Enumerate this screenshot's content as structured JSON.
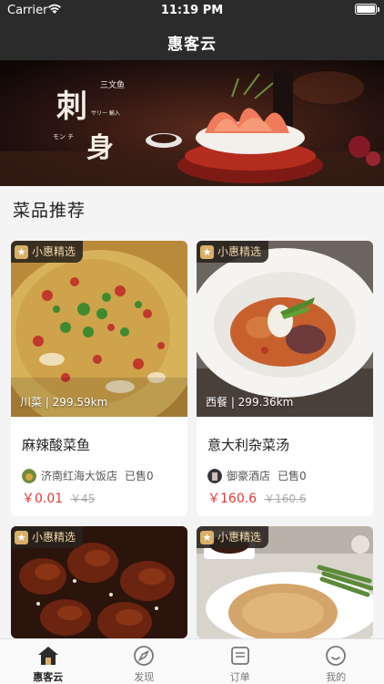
{
  "status": {
    "carrier": "Carrier",
    "time": "11:19 PM"
  },
  "nav": {
    "title": "惠客云"
  },
  "banner": {
    "text": [
      "刺",
      "身",
      "三文鱼",
      "モン チ",
      "サリー 輸入"
    ]
  },
  "section": {
    "title": "菜品推荐"
  },
  "cards": [
    {
      "tag": "小惠精选",
      "meta": "川菜 | 299.59km",
      "name": "麻辣酸菜鱼",
      "shop": "济南红海大饭店",
      "sold": "已售0",
      "price": "￥0.01",
      "old_price": "￥45"
    },
    {
      "tag": "小惠精选",
      "meta": "西餐 | 299.36km",
      "name": "意大利杂菜汤",
      "shop": "御豪酒店",
      "sold": "已售0",
      "price": "￥160.6",
      "old_price": "￥160.6"
    },
    {
      "tag": "小惠精选"
    },
    {
      "tag": "小惠精选"
    }
  ],
  "tabs": [
    {
      "label": "惠客云",
      "icon": "home-icon",
      "active": true
    },
    {
      "label": "发现",
      "icon": "compass-icon",
      "active": false
    },
    {
      "label": "订单",
      "icon": "order-icon",
      "active": false
    },
    {
      "label": "我的",
      "icon": "profile-icon",
      "active": false
    }
  ],
  "colors": {
    "nav_bg": "#2b2b2b",
    "price": "#e23a3a",
    "tag_bg": "#28221c",
    "tag_text": "#f0d9a8",
    "star": "#d8b06a"
  }
}
